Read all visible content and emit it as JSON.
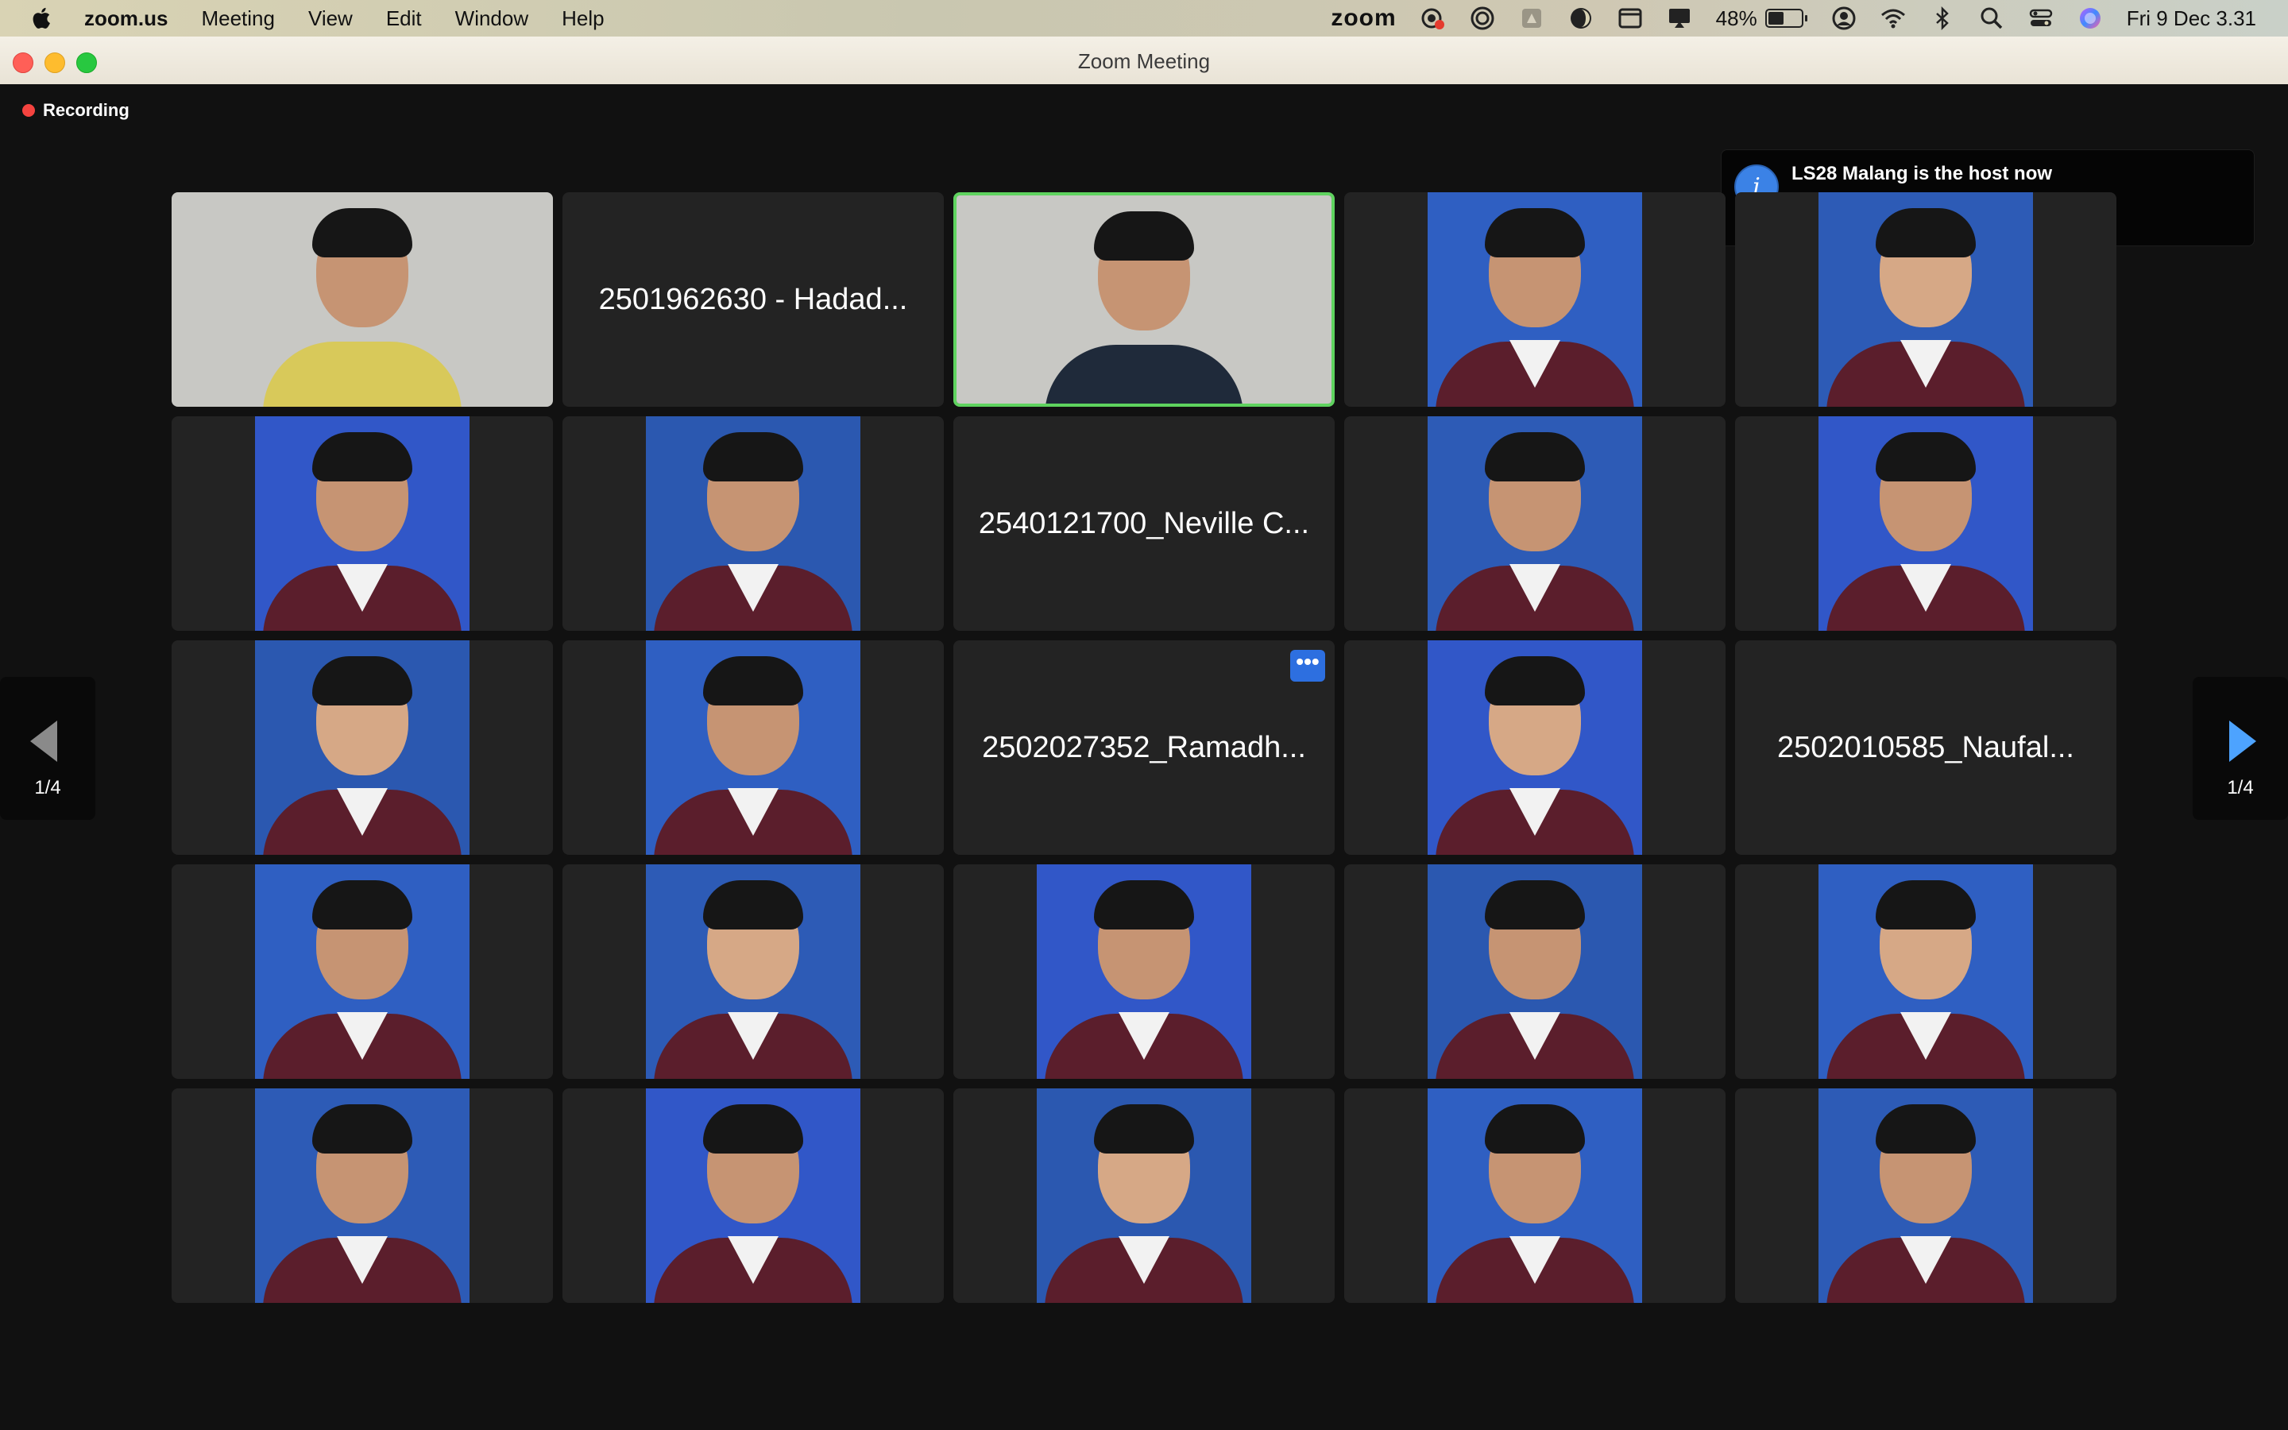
{
  "menubar": {
    "app_name": "zoom.us",
    "menus": [
      "Meeting",
      "View",
      "Edit",
      "Window",
      "Help"
    ],
    "status_logo": "zoom",
    "battery_percent": "48%",
    "battery_level": 0.48,
    "datetime": "Fri 9 Dec  3.31",
    "icons": [
      "apple-icon",
      "screen-recorder-icon",
      "focus-icon",
      "app-icon",
      "night-icon",
      "window-icon",
      "airplay-icon",
      "user-account-icon",
      "wifi-icon",
      "bluetooth-icon",
      "search-icon",
      "control-center-icon",
      "siri-icon"
    ]
  },
  "window": {
    "title": "Zoom Meeting"
  },
  "meeting": {
    "recording_label": "Recording",
    "recording_color": "#f5433f",
    "notification": "LS28 Malang is the host now",
    "active_speaker_color": "#5fd35f",
    "page_left": "1/4",
    "page_right": "1/4",
    "tiles": [
      {
        "kind": "video"
      },
      {
        "kind": "name",
        "label": "2501962630 - Hadad..."
      },
      {
        "kind": "video",
        "active": true
      },
      {
        "kind": "photo"
      },
      {
        "kind": "photo"
      },
      {
        "kind": "photo"
      },
      {
        "kind": "photo"
      },
      {
        "kind": "name",
        "label": "2540121700_Neville C..."
      },
      {
        "kind": "photo"
      },
      {
        "kind": "photo"
      },
      {
        "kind": "photo"
      },
      {
        "kind": "photo"
      },
      {
        "kind": "name",
        "label": "2502027352_Ramadh...",
        "menu": true
      },
      {
        "kind": "photo"
      },
      {
        "kind": "name",
        "label": "2502010585_Naufal..."
      },
      {
        "kind": "photo"
      },
      {
        "kind": "photo"
      },
      {
        "kind": "photo"
      },
      {
        "kind": "photo"
      },
      {
        "kind": "photo"
      },
      {
        "kind": "photo"
      },
      {
        "kind": "photo"
      },
      {
        "kind": "photo"
      },
      {
        "kind": "photo"
      },
      {
        "kind": "photo"
      }
    ]
  }
}
